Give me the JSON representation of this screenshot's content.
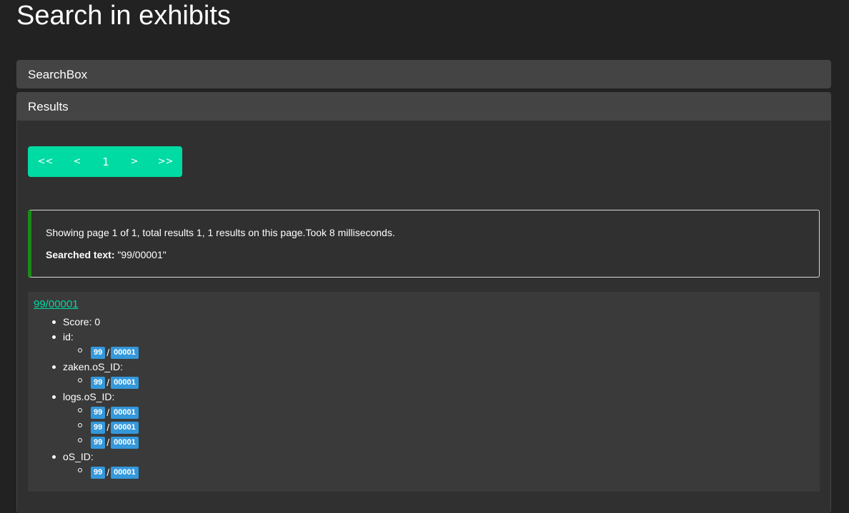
{
  "page_title": "Search in exhibits",
  "panels": {
    "searchbox_title": "SearchBox",
    "results_title": "Results"
  },
  "pagination": {
    "first": "<<",
    "prev": "<",
    "current": "1",
    "next": ">",
    "last": ">>"
  },
  "info": {
    "summary": "Showing page 1 of 1, total results 1, 1 results on this page.Took 8 milliseconds.",
    "searched_label": "Searched text:",
    "searched_value": "\"99/00001\""
  },
  "result": {
    "title": "99/00001",
    "score": "Score: 0",
    "separator": "/",
    "fields": [
      {
        "label": "id:",
        "values": [
          [
            "99",
            "00001"
          ]
        ]
      },
      {
        "label": "zaken.oS_ID:",
        "values": [
          [
            "99",
            "00001"
          ]
        ]
      },
      {
        "label": "logs.oS_ID:",
        "values": [
          [
            "99",
            "00001"
          ],
          [
            "99",
            "00001"
          ],
          [
            "99",
            "00001"
          ]
        ]
      },
      {
        "label": "oS_ID:",
        "values": [
          [
            "99",
            "00001"
          ]
        ]
      }
    ]
  },
  "colors": {
    "background": "#222222",
    "panel_heading": "#444444",
    "pagination": "#00dba3",
    "badge": "#3498db",
    "link": "#00dba3",
    "info_accent": "#1a8a1a"
  }
}
